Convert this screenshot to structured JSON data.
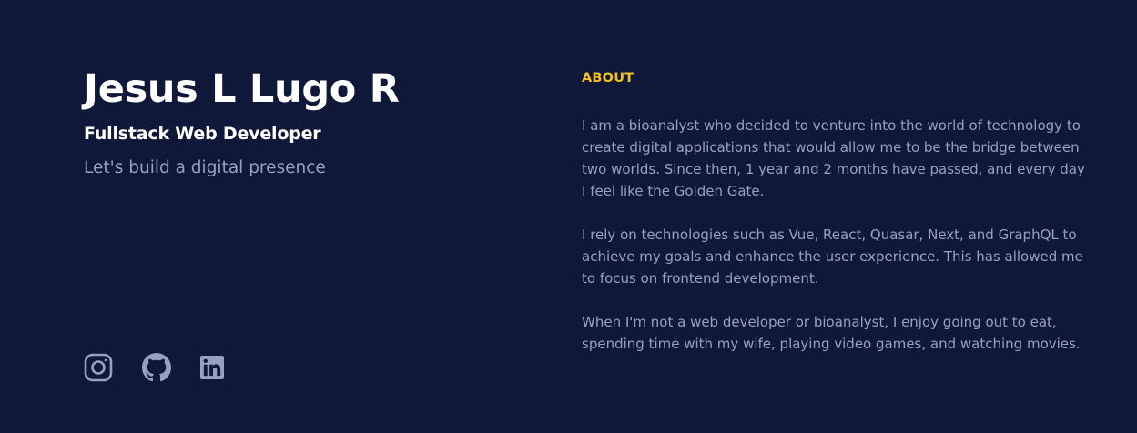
{
  "profile": {
    "name": "Jesus L Lugo R",
    "role": "Fullstack Web Developer",
    "tagline": "Let's build a digital presence"
  },
  "socials": [
    {
      "icon": "instagram-icon",
      "label": "Instagram"
    },
    {
      "icon": "github-icon",
      "label": "GitHub"
    },
    {
      "icon": "linkedin-icon",
      "label": "LinkedIn"
    }
  ],
  "about": {
    "heading": "ABOUT",
    "paragraphs": [
      "I am a bioanalyst who decided to venture into the world of technology to create digital applications that would allow me to be the bridge between two worlds. Since then, 1 year and 2 months have passed, and every day I feel like the Golden Gate.",
      "I rely on technologies such as Vue, React, Quasar, Next, and GraphQL to achieve my goals and enhance the user experience. This has allowed me to focus on frontend development.",
      "When I'm not a web developer or bioanalyst, I enjoy going out to eat, spending time with my wife, playing video games, and watching movies."
    ]
  },
  "colors": {
    "background": "#101839",
    "heading": "#ffffff",
    "body_text": "#94a2bf",
    "accent": "#f8c220"
  }
}
